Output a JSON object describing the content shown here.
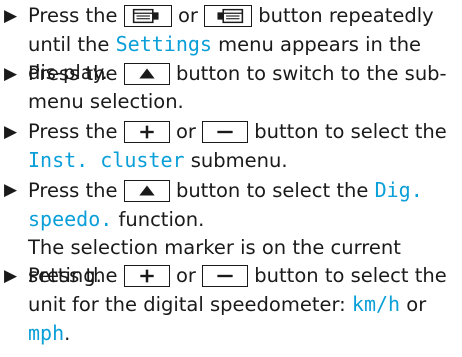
{
  "steps": [
    {
      "marker": "▶",
      "parts": [
        "Press the",
        "or",
        "button repeatedly until the",
        "Settings",
        "menu appears in the dis-play."
      ]
    },
    {
      "marker": "▶",
      "parts": [
        "Press the",
        "button to switch to the sub-menu selection."
      ]
    },
    {
      "marker": "▶",
      "parts": [
        "Press the",
        "or",
        "button to select the",
        "Inst. cluster",
        "submenu."
      ]
    },
    {
      "marker": "▶",
      "parts": [
        "Press the",
        "button to select the",
        "Dig. speedo.",
        "function."
      ],
      "note": "The selection marker is on the current setting."
    },
    {
      "marker": "▶",
      "parts": [
        "Press the",
        "or",
        "button to select the unit for the digital speedometer:",
        "km/h",
        "or",
        "mph",
        "."
      ]
    }
  ],
  "icons": {
    "page_left": "display-page-left-icon",
    "page_right": "display-page-right-icon",
    "up": "triangle-up-icon",
    "plus": "plus-icon",
    "minus": "minus-icon"
  },
  "colors": {
    "accent": "#0a9fd8",
    "text": "#1a1a1a"
  }
}
